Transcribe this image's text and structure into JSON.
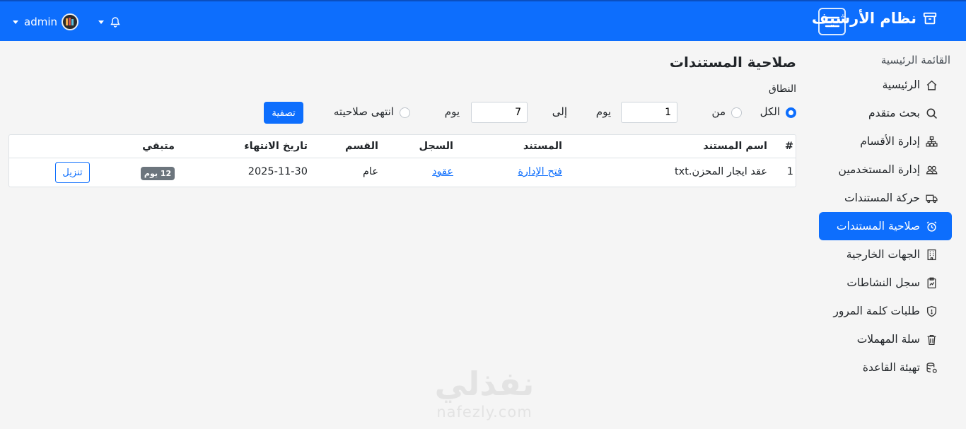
{
  "app": {
    "brand": "نظام الأرشيف",
    "user": "admin"
  },
  "sidebar": {
    "heading": "القائمة الرئيسية",
    "items": [
      {
        "label": "الرئيسية",
        "icon": "house-icon"
      },
      {
        "label": "بحث متقدم",
        "icon": "search-icon"
      },
      {
        "label": "إدارة الأقسام",
        "icon": "diagram-icon"
      },
      {
        "label": "إدارة المستخدمين",
        "icon": "people-icon"
      },
      {
        "label": "حركة المستندات",
        "icon": "truck-icon"
      },
      {
        "label": "صلاحية المستندات",
        "icon": "alarm-icon",
        "active": true
      },
      {
        "label": "الجهات الخارجية",
        "icon": "building-icon"
      },
      {
        "label": "سجل النشاطات",
        "icon": "clipboard-icon"
      },
      {
        "label": "طلبات كلمة المرور",
        "icon": "shield-icon"
      },
      {
        "label": "سلة المهملات",
        "icon": "trash-icon"
      },
      {
        "label": "تهيئة القاعدة",
        "icon": "database-gear-icon"
      }
    ]
  },
  "main": {
    "title": "صلاحية المستندات",
    "range_label": "النطاق",
    "filters": {
      "all": "الكل",
      "from": "من",
      "from_value": "1",
      "day1": "يوم",
      "to": "إلى",
      "to_value": "7",
      "day2": "يوم",
      "expired": "انتهى صلاحيته",
      "filter_button": "تصفية"
    },
    "table": {
      "headers": {
        "num": "#",
        "name": "اسم المستند",
        "doc": "المستند",
        "record": "السجل",
        "dept": "القسم",
        "expiry": "تاريخ الانتهاء",
        "remaining": "متبقي"
      },
      "rows": [
        {
          "num": "1",
          "name": "عقد ايجار المحزن.txt",
          "doc": "فتح الإدارة",
          "record": "عقود",
          "dept": "عام",
          "expiry": "2025-11-30",
          "remaining": "12 يوم",
          "action": "تنزيل"
        }
      ]
    }
  },
  "watermark": {
    "arabic": "نفذلي",
    "latin": "nafezly.com"
  },
  "colors": {
    "primary": "#0d6efd",
    "badge": "#6c757d",
    "background": "#f5f5f5"
  }
}
